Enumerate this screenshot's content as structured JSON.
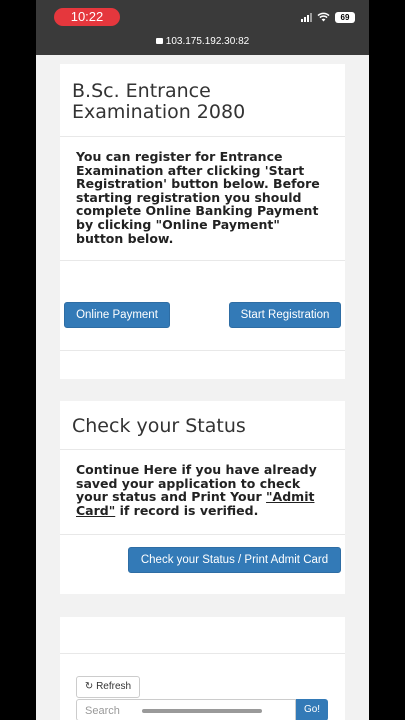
{
  "status_bar": {
    "time": "10:22",
    "battery": "69",
    "url": "103.175.192.30:82"
  },
  "registration_card": {
    "title": "B.Sc. Entrance Examination 2080",
    "body": "You can register for Entrance Examination after clicking 'Start Registration' button below. Before starting registration you should complete Online Banking Payment by clicking \"Online Payment\" button below.",
    "online_payment_label": "Online Payment",
    "start_registration_label": "Start Registration"
  },
  "status_card": {
    "title": "Check your Status",
    "body_part1": "Continue Here if you have already saved your application to check your status and Print Your ",
    "admit_card_link": "\"Admit Card\"",
    "body_part2": " if record is verified.",
    "check_status_label": "Check your Status / Print Admit Card"
  },
  "captcha_area": {
    "refresh_label": "Refresh",
    "search_placeholder": "Search",
    "go_label": "Go!"
  },
  "colors": {
    "primary_button": "#337ab7",
    "time_pill": "#e5373d"
  },
  "icons": {
    "lock": "lock-icon",
    "refresh": "refresh-icon",
    "wifi": "wifi-icon",
    "signal": "signal-icon",
    "battery": "battery-icon"
  }
}
